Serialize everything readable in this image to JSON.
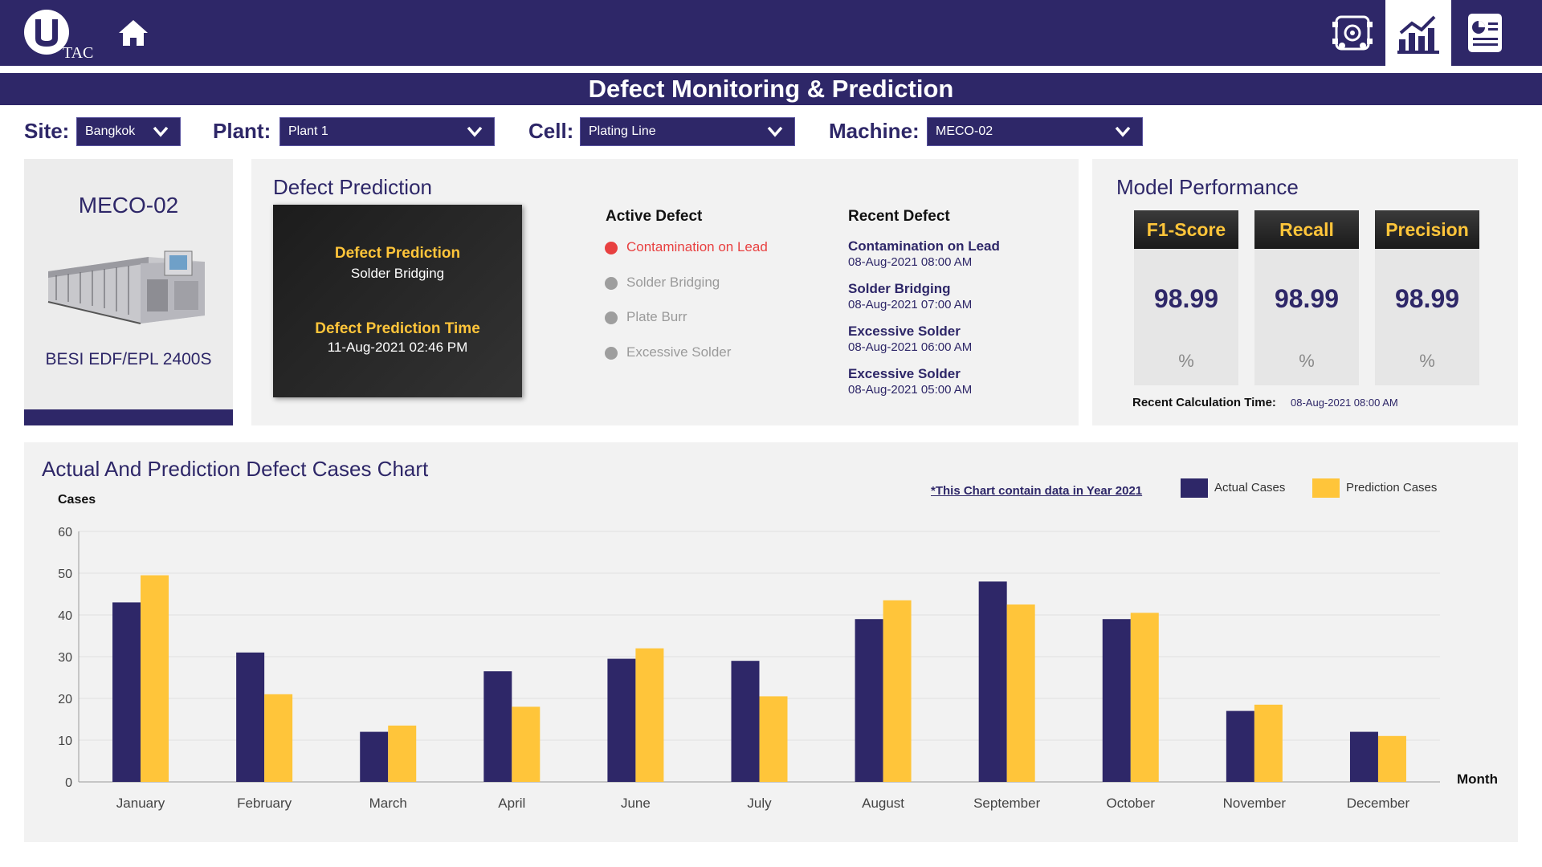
{
  "header": {
    "logo_text": "TAC",
    "nav": [
      "machine-settings-icon",
      "dashboard-chart-icon",
      "report-icon"
    ],
    "page_title": "Defect Monitoring & Prediction"
  },
  "filters": {
    "site": {
      "label": "Site:",
      "value": "Bangkok"
    },
    "plant": {
      "label": "Plant:",
      "value": "Plant 1"
    },
    "cell": {
      "label": "Cell:",
      "value": "Plating Line"
    },
    "machine": {
      "label": "Machine:",
      "value": "MECO-02"
    }
  },
  "machine_card": {
    "name": "MECO-02",
    "model": "BESI EDF/EPL 2400S"
  },
  "defect_prediction": {
    "title": "Defect Prediction",
    "prediction_label": "Defect Prediction",
    "prediction_value": "Solder Bridging",
    "time_label": "Defect Prediction Time",
    "time_value": "11-Aug-2021 02:46 PM",
    "active_heading": "Active Defect",
    "active_items": [
      {
        "label": "Contamination on Lead",
        "active": true
      },
      {
        "label": "Solder Bridging",
        "active": false
      },
      {
        "label": "Plate Burr",
        "active": false
      },
      {
        "label": "Excessive Solder",
        "active": false
      }
    ],
    "recent_heading": "Recent Defect",
    "recent_items": [
      {
        "name": "Contamination on Lead",
        "time": "08-Aug-2021 08:00 AM"
      },
      {
        "name": "Solder Bridging",
        "time": "08-Aug-2021 07:00 AM"
      },
      {
        "name": "Excessive Solder",
        "time": "08-Aug-2021 06:00 AM"
      },
      {
        "name": "Excessive Solder",
        "time": "08-Aug-2021 05:00 AM"
      }
    ]
  },
  "model_performance": {
    "title": "Model Performance",
    "metrics": [
      {
        "label": "F1-Score",
        "value": "98.99",
        "unit": "%"
      },
      {
        "label": "Recall",
        "value": "98.99",
        "unit": "%"
      },
      {
        "label": "Precision",
        "value": "98.99",
        "unit": "%"
      }
    ],
    "calc_label": "Recent Calculation Time:",
    "calc_value": "08-Aug-2021 08:00 AM"
  },
  "colors": {
    "navy": "#2e2768",
    "gold": "#ffc53a",
    "active_red": "#e84040",
    "inactive_grey": "#9e9e9e"
  },
  "chart_data": {
    "type": "bar",
    "title": "Actual And Prediction Defect Cases Chart",
    "note": "*This Chart contain data in Year 2021",
    "ylabel": "Cases",
    "xlabel": "Month",
    "ylim": [
      0,
      60
    ],
    "yticks": [
      0,
      10,
      20,
      30,
      40,
      50,
      60
    ],
    "grid": true,
    "legend_position": "top-right",
    "categories": [
      "January",
      "February",
      "March",
      "April",
      "June",
      "July",
      "August",
      "September",
      "October",
      "November",
      "December"
    ],
    "series": [
      {
        "name": "Actual Cases",
        "color": "#2e2768",
        "values": [
          43,
          31,
          12,
          26.5,
          29.5,
          29,
          39,
          48,
          39,
          17,
          12
        ]
      },
      {
        "name": "Prediction Cases",
        "color": "#ffc53a",
        "values": [
          49.5,
          21,
          13.5,
          18,
          32,
          20.5,
          43.5,
          42.5,
          40.5,
          18.5,
          11
        ]
      }
    ]
  }
}
